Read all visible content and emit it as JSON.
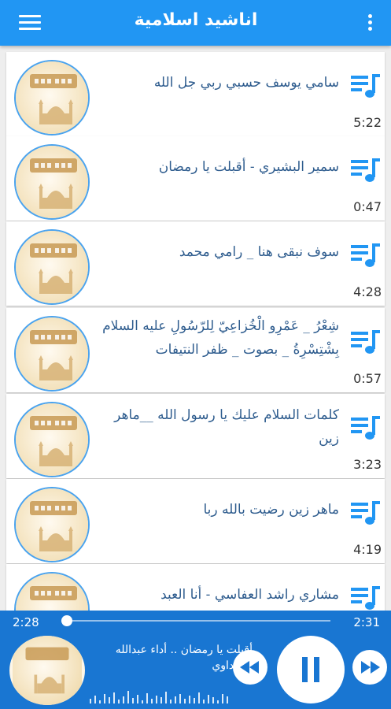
{
  "app": {
    "title": "اناشيد اسلامية",
    "accent": "#2196f3",
    "player_bg": "#1976d2",
    "menu_icon": "hamburger-menu-icon",
    "more_icon": "more-vert-icon"
  },
  "tracks": [
    {
      "title": "سامي يوسف حسبي ربي جل الله",
      "duration": "5:22"
    },
    {
      "title": "سمير البشيري - أقبلت يا رمضان",
      "duration": "0:47"
    },
    {
      "title": "سوف نبقى هنا _ رامي محمد",
      "duration": "4:28"
    },
    {
      "title": "شِعْرُ _ عَمْرِو الْخُزاعِيّ لِلرّسُولِ عليه السلام بِشْتِسْرِةُ _ بصوت _ ظفر النتيفات",
      "duration": "0:57"
    },
    {
      "title": "كلمات السلام عليك يا رسول الله __ماهر زين",
      "duration": "3:23"
    },
    {
      "title": "ماهر زين رضيت بالله ربا",
      "duration": "4:19"
    },
    {
      "title": "مشاري راشد العفاسي - أنا العبد",
      "duration": ""
    }
  ],
  "player": {
    "current_time": "2:28",
    "total_time": "2:31",
    "progress": 0.02,
    "now_playing_title": "أقبلت يا رمضان .. أداء عبدالله المهداوي"
  }
}
